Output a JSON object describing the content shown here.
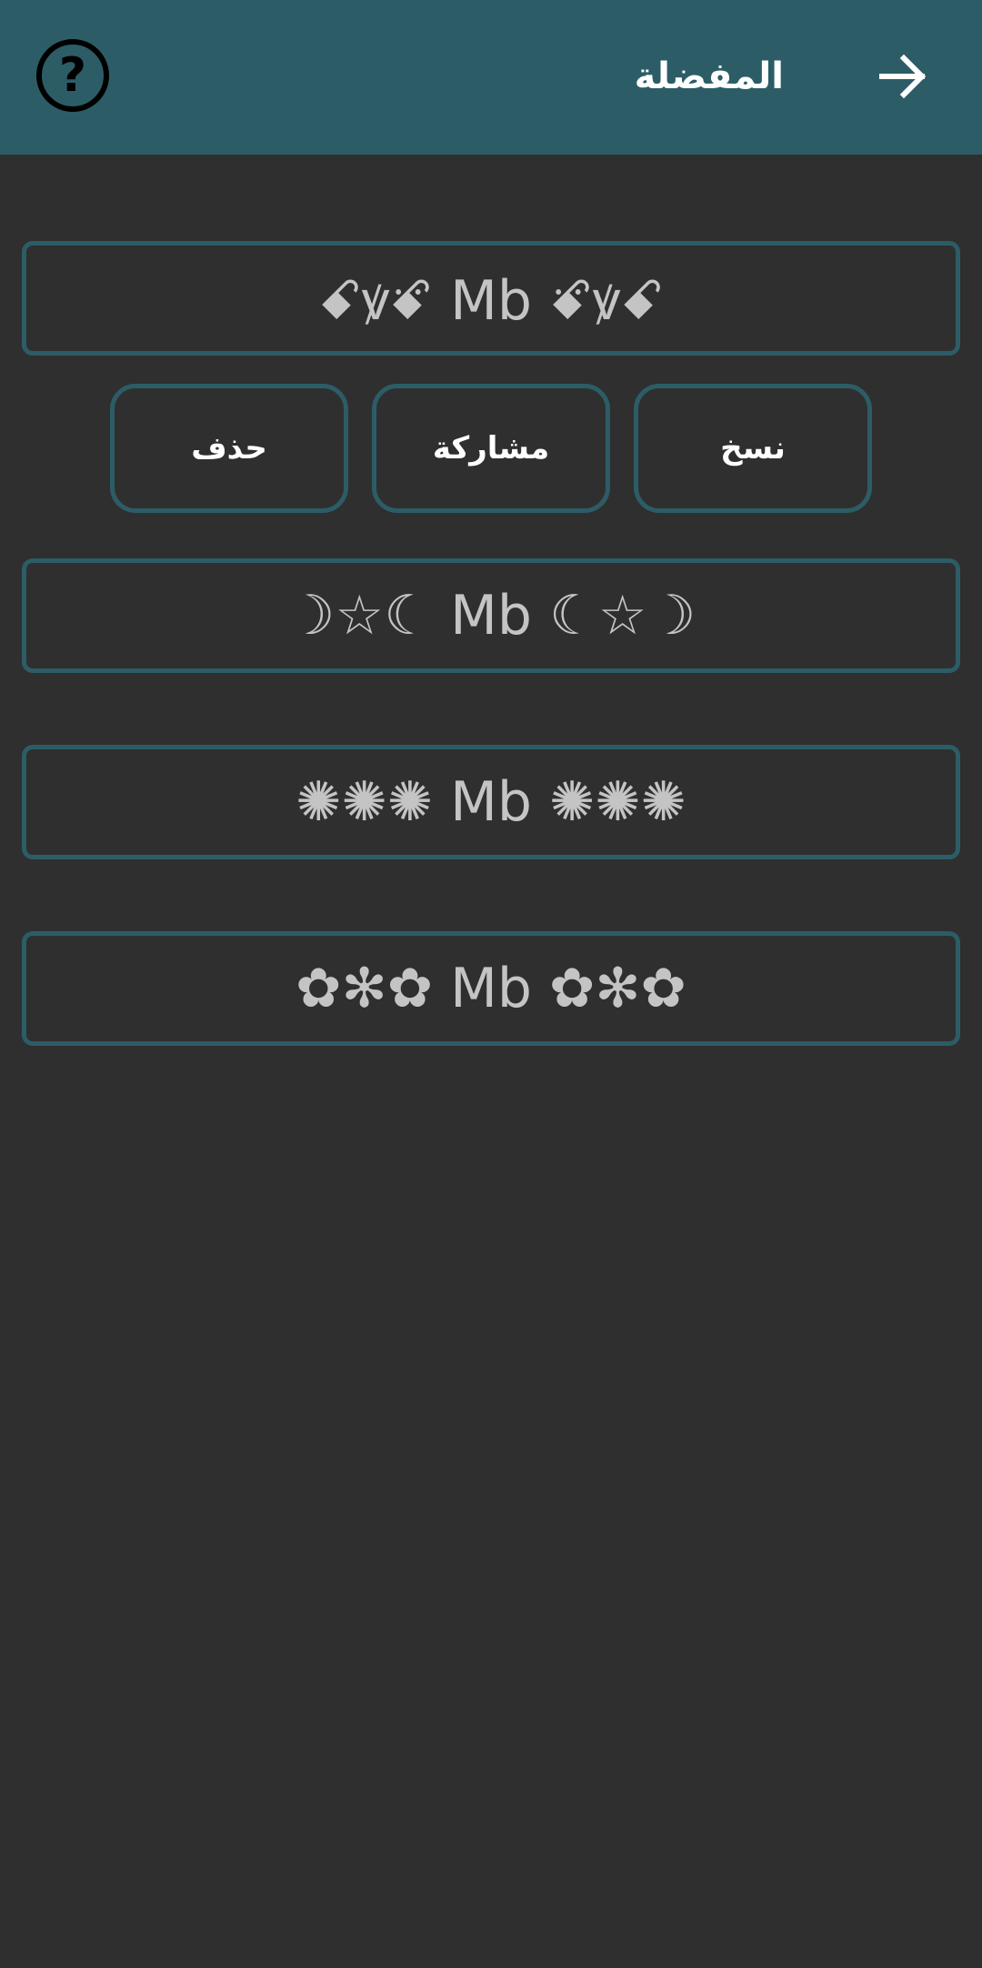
{
  "header": {
    "title": "المفضلة",
    "help_glyph": "?",
    "help_icon": "help-circle-icon",
    "back_icon": "arrow-right-icon",
    "background_color": "#2c5d67",
    "text_color": "#ffffff"
  },
  "favorites": [
    {
      "text": "ꗃꝟꗄ Mb ꗄꝟꗃ"
    },
    {
      "text": "☽☆☾ Mb ☾☆☽"
    },
    {
      "text": "✺✺✺ Mb ✺✺✺"
    },
    {
      "text": "✿✻✿ Mb ✿✻✿"
    }
  ],
  "actions": {
    "copy_label": "نسخ",
    "share_label": "مشاركة",
    "delete_label": "حذف"
  },
  "colors": {
    "background": "#2f2f2f",
    "card_border": "#2c5d67",
    "card_text": "#c4c4c4"
  }
}
